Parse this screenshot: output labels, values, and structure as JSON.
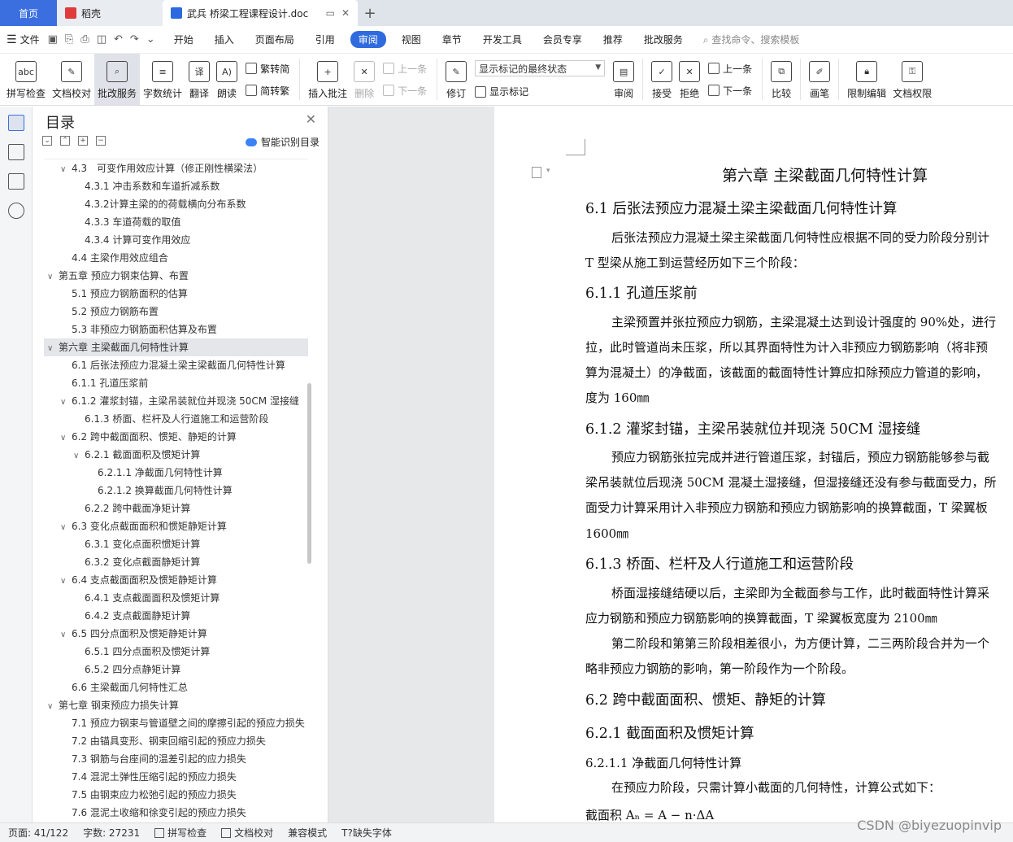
{
  "tabs": {
    "home": "首页",
    "daoke": "稻壳",
    "doc": "武兵 桥梁工程课程设计.doc",
    "add": "+"
  },
  "menubar": {
    "file": "文件",
    "items": [
      "开始",
      "插入",
      "页面布局",
      "引用",
      "审阅",
      "视图",
      "章节",
      "开发工具",
      "会员专享",
      "推荐",
      "批改服务"
    ],
    "active": "审阅",
    "search": "查找命令、搜索模板"
  },
  "ribbon": {
    "spell": "拼写检查",
    "proofread": "文档校对",
    "review_service": "批改服务",
    "word_count": "字数统计",
    "translate": "翻译",
    "read_aloud": "朗读",
    "trad": "繁转简",
    "simp": "简转繁",
    "insert_comment": "插入批注",
    "delete": "删除",
    "prev_comment": "上一条",
    "next_comment": "下一条",
    "track": "修订",
    "markup_state": "显示标记的最终状态",
    "show_markup": "显示标记",
    "review": "审阅",
    "accept": "接受",
    "reject": "拒绝",
    "prev": "上一条",
    "next": "下一条",
    "compare": "比较",
    "pen": "画笔",
    "restrict": "限制编辑",
    "doc_perm": "文档权限"
  },
  "toc": {
    "title": "目录",
    "smart": "智能识别目录",
    "items": [
      {
        "level": 2,
        "arrow": "v",
        "text": "4.3　可变作用效应计算（修正刚性横梁法）"
      },
      {
        "level": 3,
        "arrow": "",
        "text": "4.3.1  冲击系数和车道折减系数"
      },
      {
        "level": 3,
        "arrow": "",
        "text": "4.3.2计算主梁的的荷载横向分布系数"
      },
      {
        "level": 3,
        "arrow": "",
        "text": "4.3.3  车道荷载的取值"
      },
      {
        "level": 3,
        "arrow": "",
        "text": "4.3.4  计算可变作用效应"
      },
      {
        "level": 2,
        "arrow": "",
        "text": "4.4  主梁作用效应组合"
      },
      {
        "level": 1,
        "arrow": "v",
        "text": "第五章  预应力钢束估算、布置"
      },
      {
        "level": 2,
        "arrow": "",
        "text": "5.1 预应力钢筋面积的估算"
      },
      {
        "level": 2,
        "arrow": "",
        "text": "5.2 预应力钢筋布置"
      },
      {
        "level": 2,
        "arrow": "",
        "text": "5.3 非预应力钢筋面积估算及布置"
      },
      {
        "level": 1,
        "arrow": "v",
        "text": "第六章  主梁截面几何特性计算"
      },
      {
        "level": 2,
        "arrow": "",
        "text": "6.1 后张法预应力混凝土梁主梁截面几何特性计算"
      },
      {
        "level": 2,
        "arrow": "",
        "text": "6.1.1  孔道压浆前"
      },
      {
        "level": 2,
        "arrow": "v",
        "text": "6.1.2 灌浆封锚，主梁吊装就位并现浇 50CM 湿接缝"
      },
      {
        "level": 3,
        "arrow": "",
        "text": "6.1.3 桥面、栏杆及人行道施工和运营阶段"
      },
      {
        "level": 2,
        "arrow": "v",
        "text": "6.2 跨中截面面积、惯矩、静矩的计算"
      },
      {
        "level": 3,
        "arrow": "v",
        "text": "6.2.1  截面面积及惯矩计算"
      },
      {
        "level": 4,
        "arrow": "",
        "text": "6.2.1.1 净截面几何特性计算"
      },
      {
        "level": 4,
        "arrow": "",
        "text": "6.2.1.2 换算截面几何特性计算"
      },
      {
        "level": 3,
        "arrow": "",
        "text": "6.2.2 跨中截面净矩计算"
      },
      {
        "level": 2,
        "arrow": "v",
        "text": "6.3  变化点截面面积和惯矩静矩计算"
      },
      {
        "level": 3,
        "arrow": "",
        "text": "6.3.1  变化点面积惯矩计算"
      },
      {
        "level": 3,
        "arrow": "",
        "text": "6.3.2  变化点截面静矩计算"
      },
      {
        "level": 2,
        "arrow": "v",
        "text": "6.4  支点截面面积及惯矩静矩计算"
      },
      {
        "level": 3,
        "arrow": "",
        "text": "6.4.1  支点截面面积及惯矩计算"
      },
      {
        "level": 3,
        "arrow": "",
        "text": "6.4.2  支点截面静矩计算"
      },
      {
        "level": 2,
        "arrow": "v",
        "text": "6.5 四分点面积及惯矩静矩计算"
      },
      {
        "level": 3,
        "arrow": "",
        "text": "6.5.1 四分点面积及惯矩计算"
      },
      {
        "level": 3,
        "arrow": "",
        "text": "6.5.2 四分点静矩计算"
      },
      {
        "level": 2,
        "arrow": "",
        "text": "6.6 主梁截面几何特性汇总"
      },
      {
        "level": 1,
        "arrow": "v",
        "text": "第七章  钢束预应力损失计算"
      },
      {
        "level": 2,
        "arrow": "",
        "text": "7.1  预应力钢束与管道壁之间的摩擦引起的预应力损失"
      },
      {
        "level": 2,
        "arrow": "",
        "text": "7.2  由锚具变形、钢束回缩引起的预应力损失"
      },
      {
        "level": 2,
        "arrow": "",
        "text": "7.3  钢筋与台座间的温差引起的应力损失"
      },
      {
        "level": 2,
        "arrow": "",
        "text": "7.4  混泥土弹性压缩引起的预应力损失"
      },
      {
        "level": 2,
        "arrow": "",
        "text": "7.5  由钢束应力松弛引起的预应力损失"
      },
      {
        "level": 2,
        "arrow": "",
        "text": "7.6  混泥土收缩和徐变引起的预应力损失"
      }
    ]
  },
  "document": {
    "chapter": "第六章  主梁截面几何特性计算",
    "s61": "6.1 后张法预应力混凝土梁主梁截面几何特性计算",
    "p1a": "后张法预应力混凝土梁主梁截面几何特性应根据不同的受力阶段分别计",
    "p1b": "T 型梁从施工到运营经历如下三个阶段：",
    "s611": "6.1.1  孔道压浆前",
    "p2a": "主梁预置并张拉预应力钢筋，主梁混凝土达到设计强度的 90%处，进行",
    "p2b": "拉，此时管道尚未压浆，所以其界面特性为计入非预应力钢筋影响（将非预",
    "p2c": "算为混凝土）的净截面，该截面的截面特性计算应扣除预应力管道的影响，",
    "p2d": "度为 160㎜",
    "s612": "6.1.2 灌浆封锚，主梁吊装就位并现浇 50CM 湿接缝",
    "p3a": "预应力钢筋张拉完成并进行管道压浆，封锚后，预应力钢筋能够参与截",
    "p3b": "梁吊装就位后现浇 50CM 混凝土湿接缝，但湿接缝还没有参与截面受力，所",
    "p3c": "面受力计算采用计入非预应力钢筋和预应力钢筋影响的换算截面，T 梁翼板",
    "p3d": "1600㎜",
    "s613": "6.1.3 桥面、栏杆及人行道施工和运营阶段",
    "p4a": "桥面湿接缝结硬以后，主梁即为全截面参与工作，此时截面特性计算采",
    "p4b": "应力钢筋和预应力钢筋影响的换算截面，T 梁翼板宽度为 2100㎜",
    "p5a": "第二阶段和第第三阶段相差很小，为方便计算，二三两阶段合并为一个",
    "p5b": "略非预应力钢筋的影响，第一阶段作为一个阶段。",
    "s62": "6.2 跨中截面面积、惯矩、静矩的计算",
    "s621": "6.2.1 截面面积及惯矩计算",
    "s6211": "6.2.1.1 净截面几何特性计算",
    "p6": "在预应力阶段，只需计算小截面的几何特性，计算公式如下：",
    "formula": "截面积 Aₙ = A − n·ΔA"
  },
  "status": {
    "page": "页面: 41/122",
    "words": "字数: 27231",
    "spell": "拼写检查",
    "proof": "文档校对",
    "compat": "兼容模式",
    "missing_font": "缺失字体"
  },
  "watermark": "CSDN @biyezuopinvip"
}
